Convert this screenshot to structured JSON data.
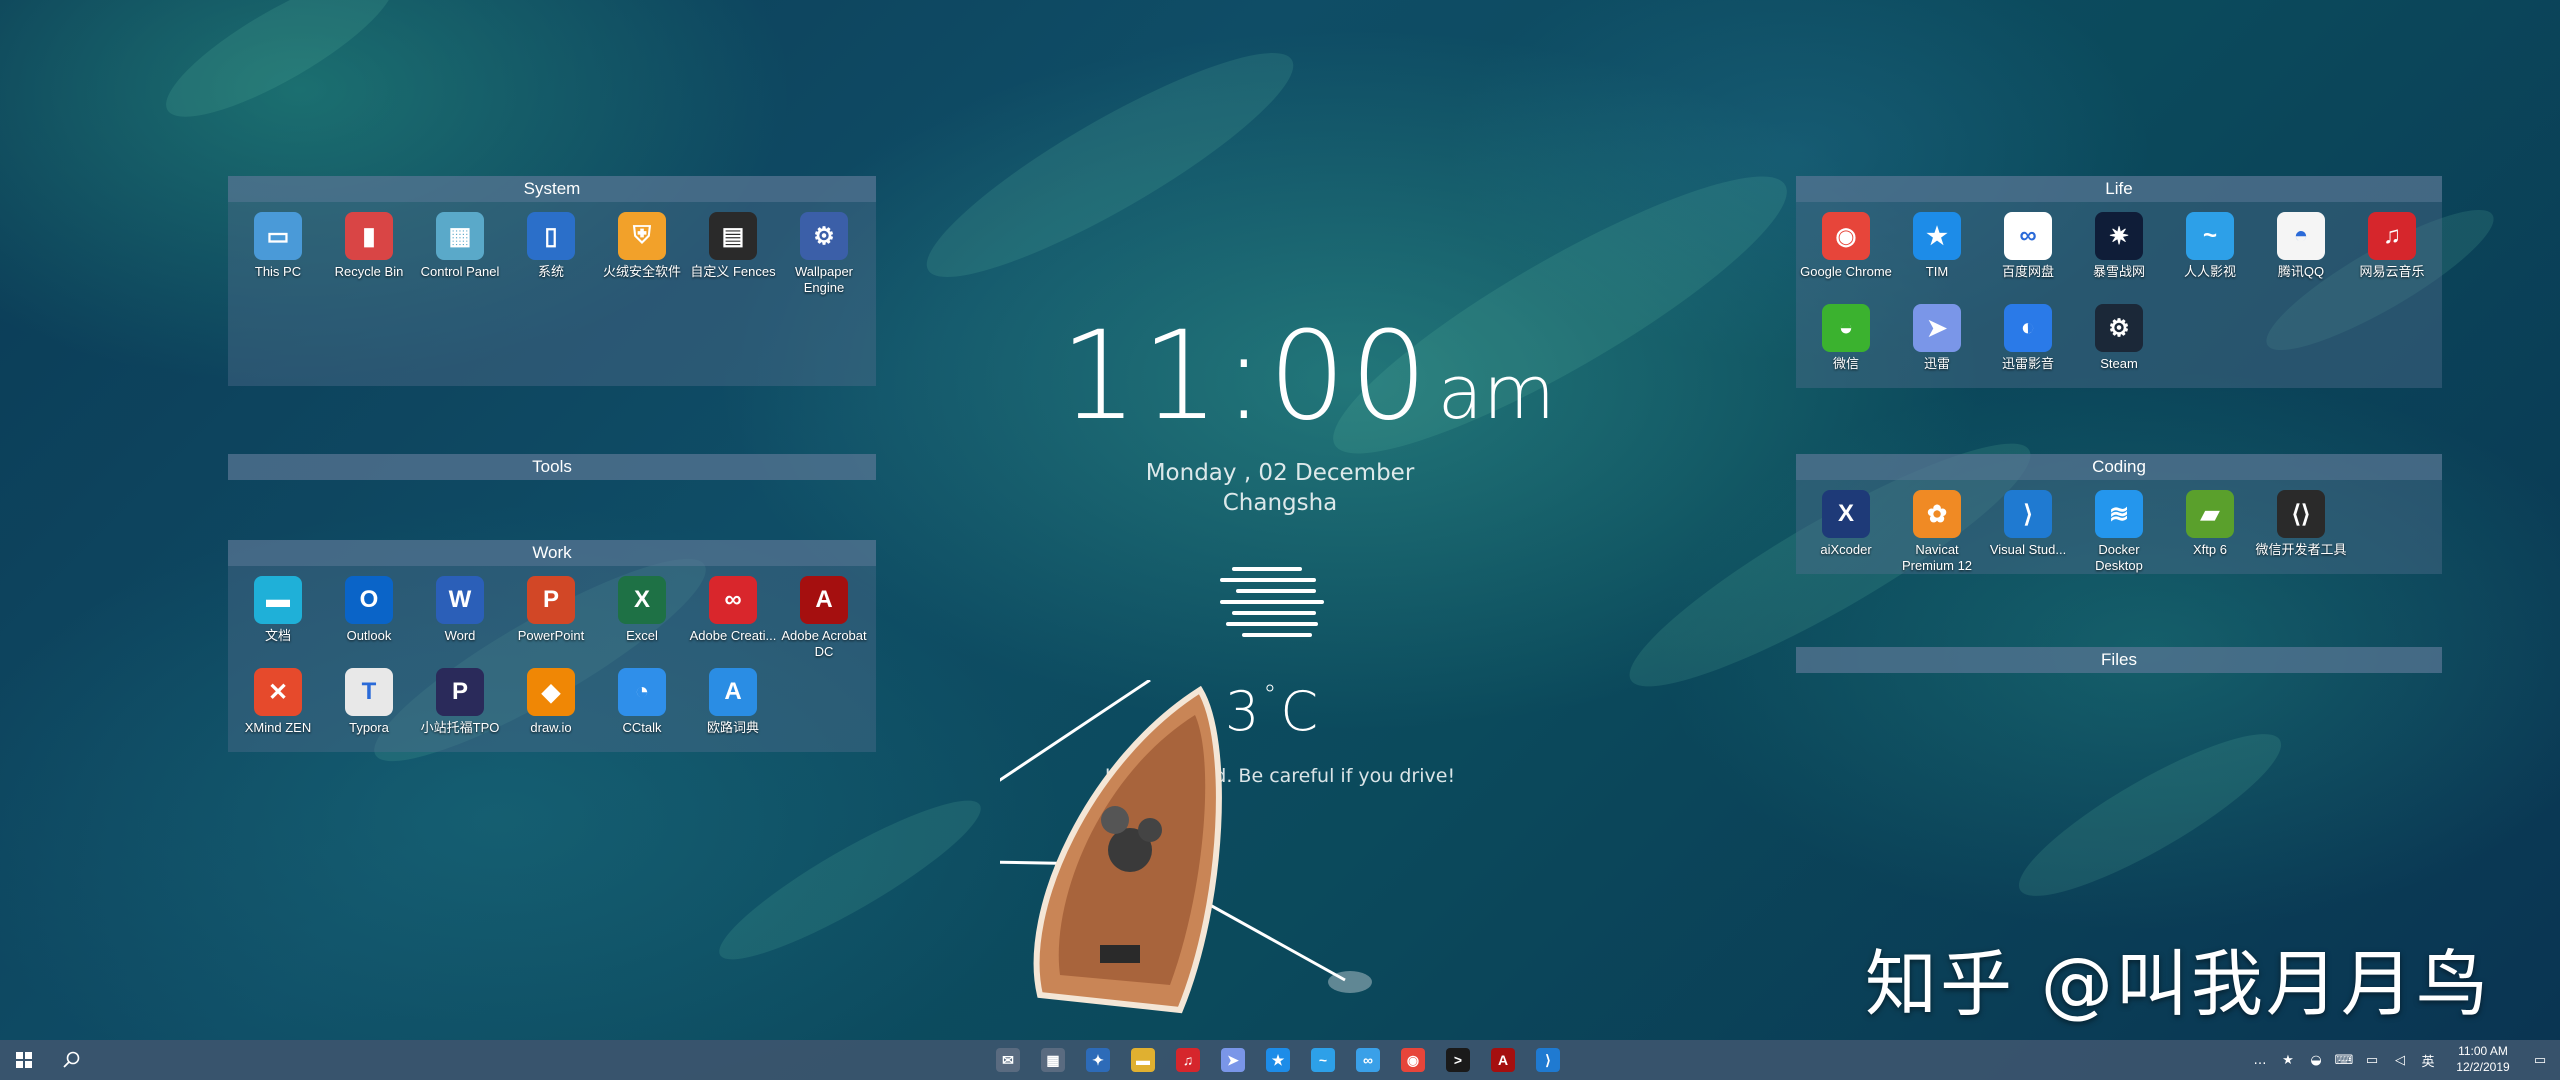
{
  "fences": {
    "system": {
      "title": "System",
      "items": [
        {
          "label": "This PC",
          "icon": "this-pc-icon",
          "color": "#4a9ad8",
          "glyph": "▭"
        },
        {
          "label": "Recycle Bin",
          "icon": "recycle-bin-icon",
          "color": "#d94545",
          "glyph": "▮"
        },
        {
          "label": "Control Panel",
          "icon": "control-panel-icon",
          "color": "#5aa9c9",
          "glyph": "▦"
        },
        {
          "label": "系统",
          "icon": "system-icon",
          "color": "#2b6fc9",
          "glyph": "▯"
        },
        {
          "label": "火绒安全软件",
          "icon": "huorong-icon",
          "color": "#f2a12a",
          "glyph": "⛨"
        },
        {
          "label": "自定义 Fences",
          "icon": "fences-icon",
          "color": "#2a2a2a",
          "glyph": "▤"
        },
        {
          "label": "Wallpaper Engine",
          "icon": "wallpaper-engine-icon",
          "color": "#3b5fa8",
          "glyph": "⚙"
        }
      ]
    },
    "tools": {
      "title": "Tools"
    },
    "work": {
      "title": "Work",
      "items": [
        {
          "label": "文档",
          "icon": "documents-folder-icon",
          "color": "#1fb0d8",
          "glyph": "▬"
        },
        {
          "label": "Outlook",
          "icon": "outlook-icon",
          "color": "#0a64c8",
          "glyph": "O"
        },
        {
          "label": "Word",
          "icon": "word-icon",
          "color": "#2b5fb8",
          "glyph": "W"
        },
        {
          "label": "PowerPoint",
          "icon": "powerpoint-icon",
          "color": "#d24726",
          "glyph": "P"
        },
        {
          "label": "Excel",
          "icon": "excel-icon",
          "color": "#1e7145",
          "glyph": "X"
        },
        {
          "label": "Adobe Creati...",
          "icon": "adobe-cc-icon",
          "color": "#d9262c",
          "glyph": "∞"
        },
        {
          "label": "Adobe Acrobat DC",
          "icon": "acrobat-icon",
          "color": "#a50f0f",
          "glyph": "A"
        },
        {
          "label": "XMind ZEN",
          "icon": "xmind-icon",
          "color": "#e64a2c",
          "glyph": "✕"
        },
        {
          "label": "Typora",
          "icon": "typora-icon",
          "color": "#e8e8e8",
          "glyph": "T"
        },
        {
          "label": "小站托福TPO",
          "icon": "tpo-icon",
          "color": "#2a2a5a",
          "glyph": "P"
        },
        {
          "label": "draw.io",
          "icon": "drawio-icon",
          "color": "#f08705",
          "glyph": "◆"
        },
        {
          "label": "CCtalk",
          "icon": "cctalk-icon",
          "color": "#2f8fea",
          "glyph": "◔"
        },
        {
          "label": "欧路词典",
          "icon": "eudic-icon",
          "color": "#2a8de4",
          "glyph": "A"
        }
      ]
    },
    "life": {
      "title": "Life",
      "items": [
        {
          "label": "Google Chrome",
          "icon": "chrome-icon",
          "color": "#e7453a",
          "glyph": "◉"
        },
        {
          "label": "TIM",
          "icon": "tim-icon",
          "color": "#1d8ce8",
          "glyph": "★"
        },
        {
          "label": "百度网盘",
          "icon": "baidu-netdisk-icon",
          "color": "#ffffff",
          "glyph": "∞"
        },
        {
          "label": "暴雪战网",
          "icon": "battlenet-icon",
          "color": "#0f1d38",
          "glyph": "✷"
        },
        {
          "label": "人人影视",
          "icon": "rrys-icon",
          "color": "#2da0e8",
          "glyph": "~"
        },
        {
          "label": "腾讯QQ",
          "icon": "qq-icon",
          "color": "#f5f5f5",
          "glyph": "◓"
        },
        {
          "label": "网易云音乐",
          "icon": "netease-music-icon",
          "color": "#d6262c",
          "glyph": "♫"
        },
        {
          "label": "微信",
          "icon": "wechat-icon",
          "color": "#3bb22f",
          "glyph": "◒"
        },
        {
          "label": "迅雷",
          "icon": "thunder-icon",
          "color": "#7a96e8",
          "glyph": "➤"
        },
        {
          "label": "迅雷影音",
          "icon": "thunder-player-icon",
          "color": "#2a7ae8",
          "glyph": "◐"
        },
        {
          "label": "Steam",
          "icon": "steam-icon",
          "color": "#1b2838",
          "glyph": "⚙"
        }
      ]
    },
    "coding": {
      "title": "Coding",
      "items": [
        {
          "label": "aiXcoder",
          "icon": "aixcoder-icon",
          "color": "#1e3a78",
          "glyph": "X"
        },
        {
          "label": "Navicat Premium 12",
          "icon": "navicat-icon",
          "color": "#f08a24",
          "glyph": "✿"
        },
        {
          "label": "Visual Stud...",
          "icon": "vscode-icon",
          "color": "#1f7ad1",
          "glyph": "⟩"
        },
        {
          "label": "Docker Desktop",
          "icon": "docker-icon",
          "color": "#2496ed",
          "glyph": "≋"
        },
        {
          "label": "Xftp 6",
          "icon": "xftp-icon",
          "color": "#5aa02c",
          "glyph": "▰"
        },
        {
          "label": "微信开发者工具",
          "icon": "wechat-devtools-icon",
          "color": "#2a2a2a",
          "glyph": "⟨⟩"
        }
      ]
    },
    "files": {
      "title": "Files"
    }
  },
  "widget": {
    "time": "11:00",
    "ampm": "am",
    "date": "Monday , 02 December",
    "city": "Changsha",
    "weather_icon": "fog-icon",
    "temperature": "3",
    "temp_unit": "C",
    "message": "It's obscured. Be careful if you drive!"
  },
  "watermark": "知乎 @叫我月月鸟",
  "taskbar": {
    "start_icon": "windows-start-icon",
    "search_icon": "search-icon",
    "pinned": [
      {
        "icon": "mail-icon",
        "color": "#5a6b80",
        "glyph": "✉"
      },
      {
        "icon": "calendar-icon",
        "color": "#5a6b80",
        "glyph": "▦"
      },
      {
        "icon": "visual-studio-icon",
        "color": "#2d6bb8",
        "glyph": "✦"
      },
      {
        "icon": "file-explorer-icon",
        "color": "#e0b030",
        "glyph": "▬"
      },
      {
        "icon": "netease-music-icon",
        "color": "#d6262c",
        "glyph": "♫"
      },
      {
        "icon": "thunder-icon",
        "color": "#7a96e8",
        "glyph": "➤"
      },
      {
        "icon": "tim-icon",
        "color": "#1d8ce8",
        "glyph": "★"
      },
      {
        "icon": "rrys-icon",
        "color": "#2da0e8",
        "glyph": "~"
      },
      {
        "icon": "baidu-netdisk-icon",
        "color": "#3aa0e8",
        "glyph": "∞"
      },
      {
        "icon": "chrome-icon",
        "color": "#e7453a",
        "glyph": "◉"
      },
      {
        "icon": "terminal-icon",
        "color": "#1a1a1a",
        "glyph": ">"
      },
      {
        "icon": "acrobat-icon",
        "color": "#a50f0f",
        "glyph": "A"
      },
      {
        "icon": "vscode-icon",
        "color": "#1f7ad1",
        "glyph": "⟩"
      }
    ],
    "tray": [
      {
        "icon": "overflow-icon",
        "glyph": "…"
      },
      {
        "icon": "tim-tray-icon",
        "glyph": "★"
      },
      {
        "icon": "wechat-tray-icon",
        "glyph": "◒"
      },
      {
        "icon": "ime-icon",
        "glyph": "⌨"
      },
      {
        "icon": "network-icon",
        "glyph": "▭"
      },
      {
        "icon": "volume-icon",
        "glyph": "◁"
      },
      {
        "icon": "language-icon",
        "glyph": "英"
      }
    ],
    "clock_time": "11:00 AM",
    "clock_date": "12/2/2019",
    "notification_icon": "notification-icon"
  }
}
